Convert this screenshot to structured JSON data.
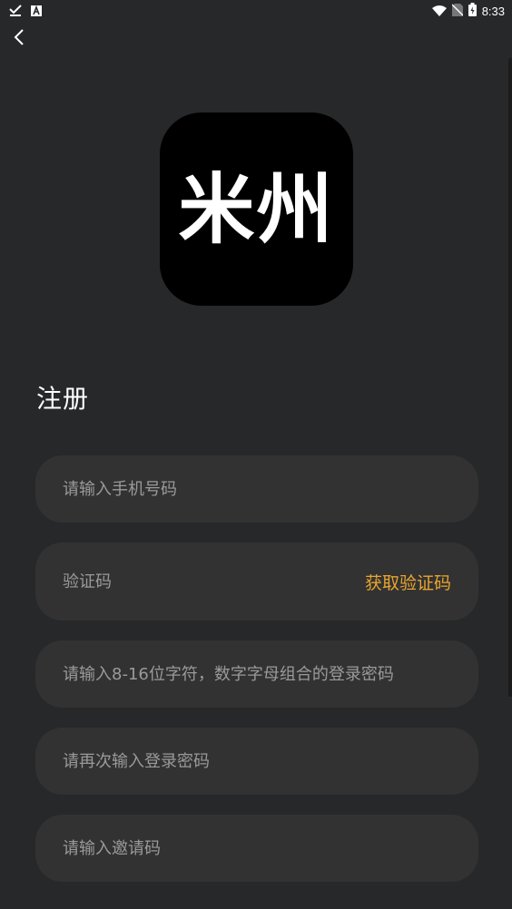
{
  "status_bar": {
    "time": "8:33"
  },
  "logo": {
    "text": "米州"
  },
  "page": {
    "title": "注册"
  },
  "form": {
    "phone_placeholder": "请输入手机号码",
    "code_placeholder": "验证码",
    "get_code_label": "获取验证码",
    "password_placeholder": "请输入8-16位字符，数字字母组合的登录密码",
    "confirm_password_placeholder": "请再次输入登录密码",
    "invite_code_placeholder": "请输入邀请码"
  },
  "colors": {
    "background": "#27282a",
    "field_background": "#323232",
    "accent": "#e9a52e",
    "placeholder": "#9a9a9a"
  },
  "icons": [
    "download-done-icon",
    "app-notification-icon",
    "wifi-icon",
    "no-sim-icon",
    "battery-charging-icon",
    "back-arrow-icon"
  ]
}
